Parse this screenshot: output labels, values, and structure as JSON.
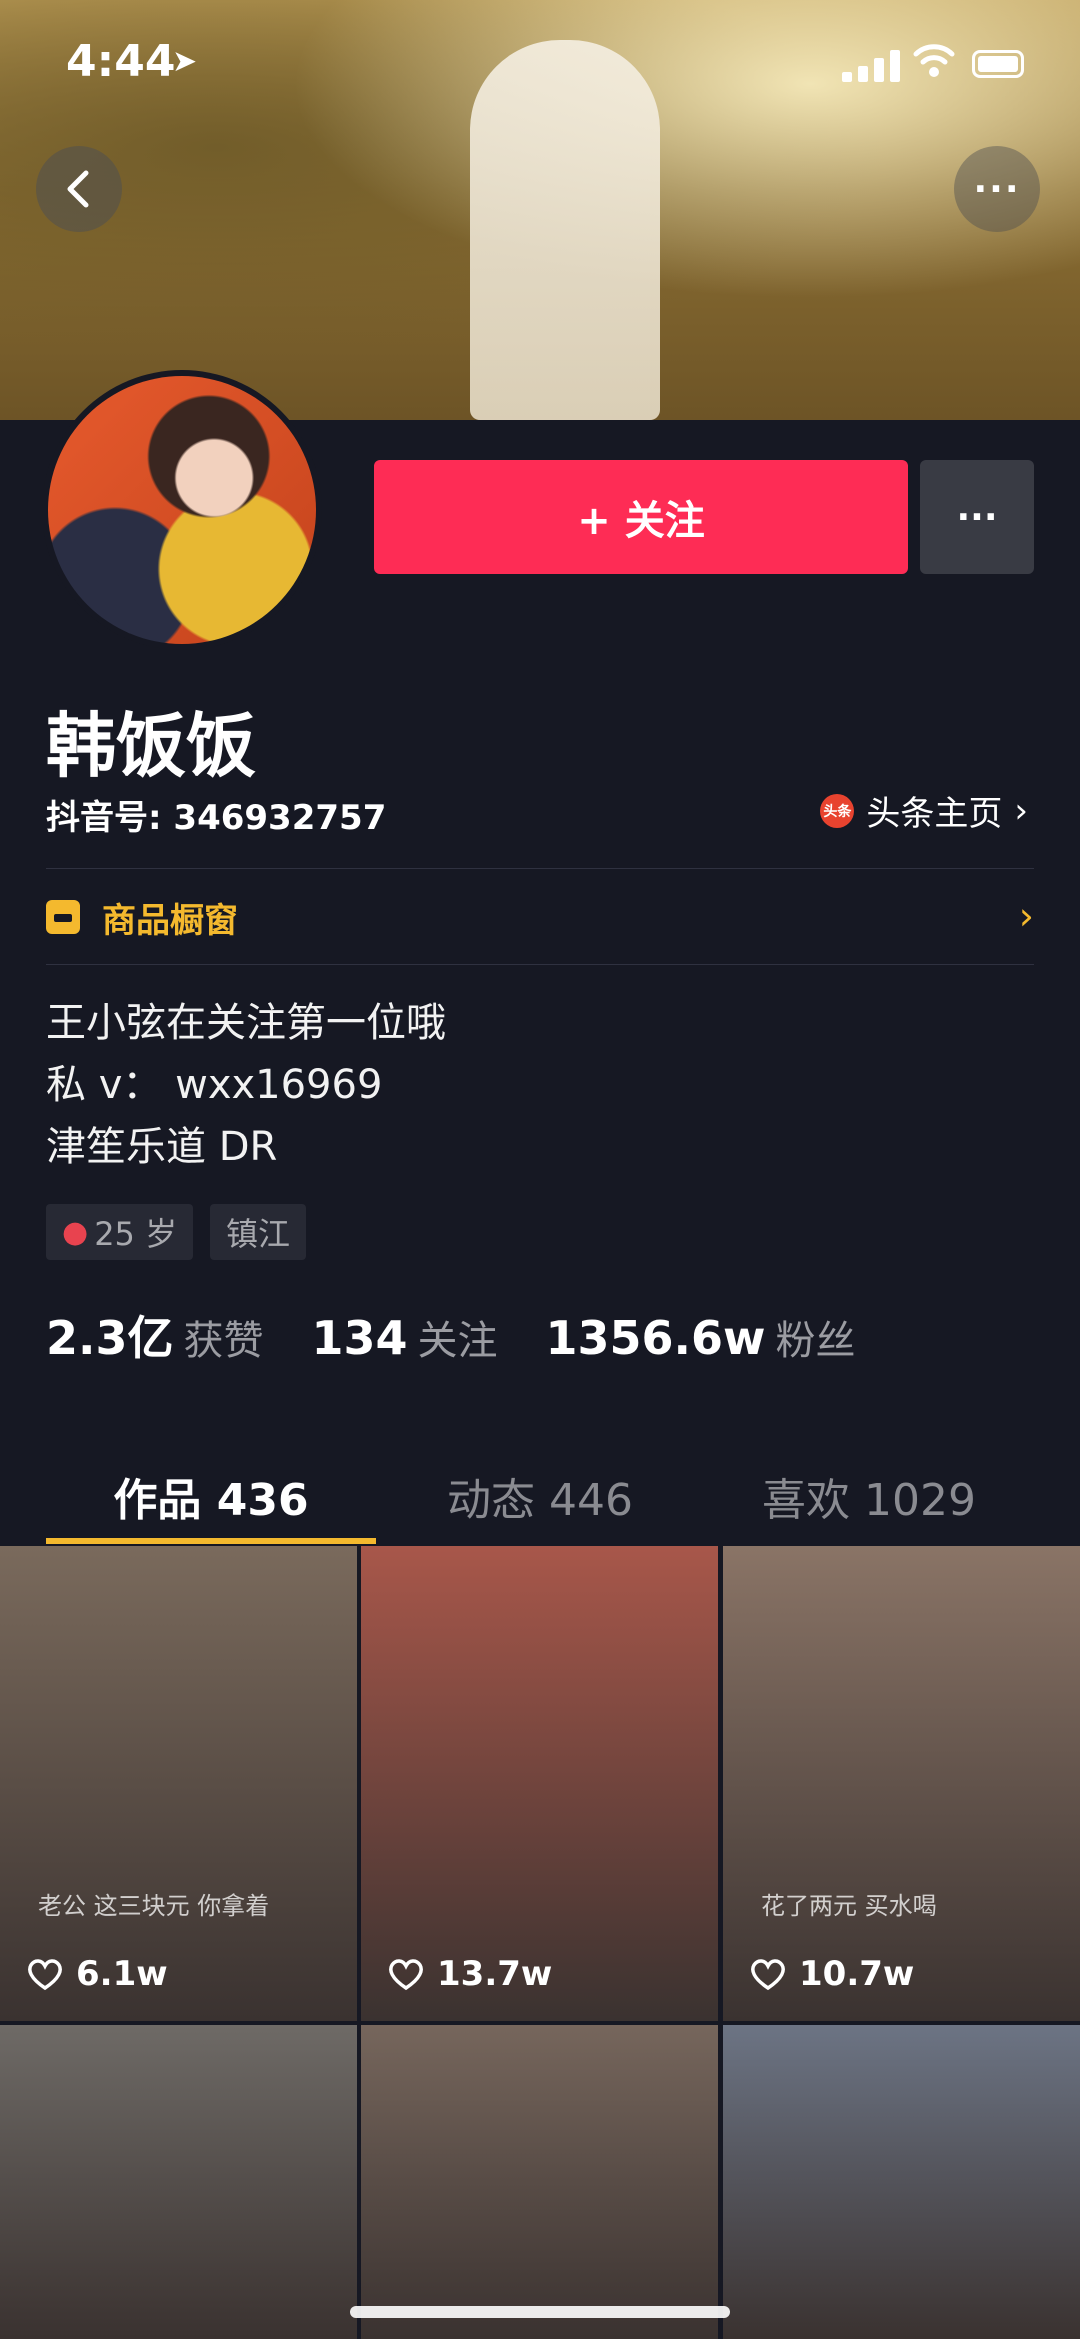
{
  "status_bar": {
    "time": "4:44"
  },
  "profile": {
    "follow_label": "+ 关注",
    "more_label": "···",
    "username": "韩饭饭",
    "douyin_id": "抖音号: 346932757",
    "toutiao_icon_text": "头条",
    "toutiao_label": "头条主页",
    "shop_label": "商品橱窗",
    "bio_lines": [
      "王小弦在关注第一位哦",
      "私 v： wxx16969",
      "津笙乐道 DR"
    ],
    "tags": [
      "25 岁",
      "镇江"
    ]
  },
  "stats": [
    {
      "value": "2.3亿",
      "label": "获赞"
    },
    {
      "value": "134",
      "label": "关注"
    },
    {
      "value": "1356.6w",
      "label": "粉丝"
    }
  ],
  "tabs": [
    {
      "label": "作品 436",
      "active": true
    },
    {
      "label": "动态 446",
      "active": false
    },
    {
      "label": "喜欢 1029",
      "active": false
    }
  ],
  "videos": [
    {
      "caption": "老公 这三块元 你拿着",
      "likes": "6.1w",
      "color": "#7a6a5c"
    },
    {
      "caption": "",
      "likes": "13.7w",
      "color": "#a8574a"
    },
    {
      "caption": "花了两元 买水喝",
      "likes": "10.7w",
      "color": "#8a7466"
    },
    {
      "caption": "",
      "likes": "",
      "color": "#6e6a66"
    },
    {
      "caption": "",
      "likes": "",
      "color": "#76665c"
    },
    {
      "caption": "",
      "likes": "",
      "color": "#6c7484"
    }
  ],
  "icons": {
    "back": "chevron-left-icon",
    "more": "ellipsis-icon",
    "heart": "heart-outline-icon",
    "gender": "female-icon"
  }
}
